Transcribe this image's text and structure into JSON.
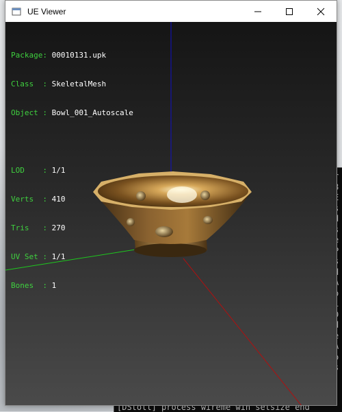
{
  "window": {
    "title": "UE Viewer",
    "controls": {
      "minimize": "minimize",
      "maximize": "maximize",
      "close": "close"
    }
  },
  "info": {
    "package": {
      "key": "Package",
      "value": "00010131.upk"
    },
    "class": {
      "key": "Class  ",
      "value": "SkeletalMesh"
    },
    "object": {
      "key": "Object ",
      "value": "Bowl_001_Autoscale"
    },
    "lod": {
      "key": "LOD    ",
      "value": "1/1"
    },
    "verts": {
      "key": "Verts  ",
      "value": "410"
    },
    "tris": {
      "key": "Tris   ",
      "value": "270"
    },
    "uvset": {
      "key": "UV Set ",
      "value": "1/1"
    },
    "bones": {
      "key": "Bones  ",
      "value": "1"
    }
  },
  "console": {
    "bottom_line": "[DStoll] process  wireme win setsize  end",
    "edge_chars": [
      "r",
      "8",
      "E",
      "s",
      "d",
      "s",
      "e",
      "P",
      "s",
      "d",
      "A",
      "o",
      "i",
      "D",
      "d",
      "e",
      "A",
      "o",
      "s"
    ]
  },
  "colors": {
    "label": "#3fd13f",
    "value": "#ffffff",
    "axis_x": "#b01010",
    "axis_y": "#1ec81e",
    "axis_z": "#1010c8"
  }
}
